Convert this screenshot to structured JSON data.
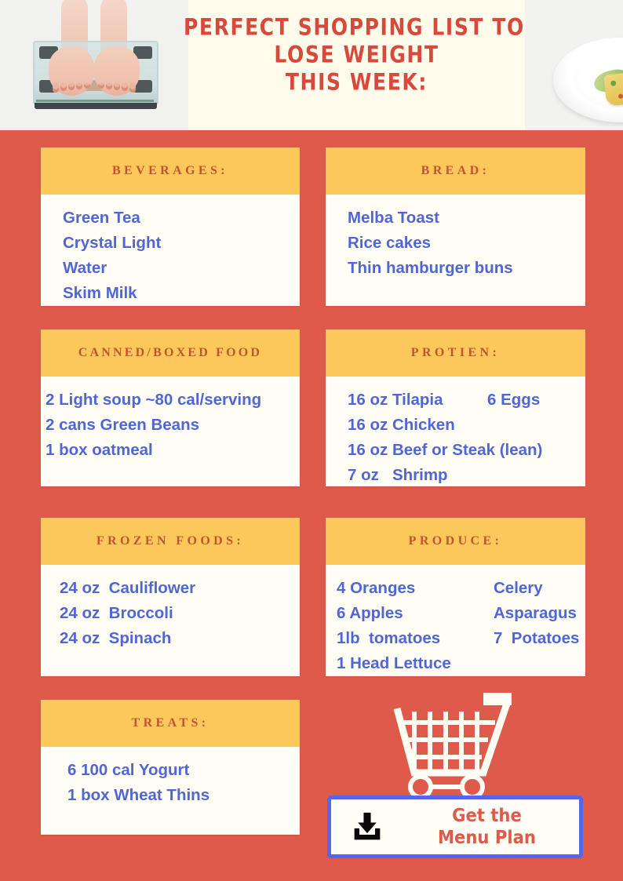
{
  "header": {
    "title_lines": [
      "Perfect Shopping List to",
      "Lose Weight",
      "This Week:"
    ],
    "left_photo_alt": "feet-on-bathroom-scale-photo",
    "right_photo_alt": "healthy-plate-frittata-tomatoes-photo",
    "title_color": "#D9483C",
    "title_panel_color": "#FFFCEB"
  },
  "theme": {
    "background": "#DE5B4B",
    "card_header_bg": "#FDC85B",
    "card_header_text": "#C2552F",
    "card_body_bg": "#FFFDF4",
    "item_text": "#4F66D6",
    "cta_border": "#5566E8",
    "cta_text": "#DE5B4B"
  },
  "cards": [
    {
      "id": "beverages",
      "heading": "Beverages:",
      "items": [
        "Green Tea",
        "Crystal Light",
        "Water",
        "Skim Milk"
      ]
    },
    {
      "id": "bread",
      "heading": "Bread:",
      "items": [
        "Melba Toast",
        "Rice cakes",
        "Thin hamburger buns"
      ]
    },
    {
      "id": "canned",
      "heading": "Canned/Boxed Food",
      "items": [
        "2 Light soup ~80 cal/serving",
        "2 cans Green Beans",
        "1 box oatmeal"
      ]
    },
    {
      "id": "protein",
      "heading": "Protien:",
      "items_left": [
        "16 oz Tilapia",
        "16 oz Chicken",
        "16 oz Beef or Steak (lean)",
        "7 oz   Shrimp"
      ],
      "items_right": [
        "6 Eggs",
        "",
        "",
        ""
      ]
    },
    {
      "id": "frozen",
      "heading": "Frozen Foods:",
      "items": [
        "24 oz  Cauliflower",
        "24 oz  Broccoli",
        "24 oz  Spinach"
      ]
    },
    {
      "id": "produce",
      "heading": "Produce:",
      "items_left": [
        "4 Oranges",
        "6 Apples",
        "1lb  tomatoes",
        "1 Head Lettuce"
      ],
      "items_right": [
        "Celery",
        "Asparagus",
        "7  Potatoes",
        ""
      ]
    },
    {
      "id": "treats",
      "heading": "Treats:",
      "items": [
        "6 100 cal Yogurt",
        "1 box Wheat Thins"
      ]
    }
  ],
  "cart_icon": "shopping-cart-icon",
  "cta": {
    "icon": "download-icon",
    "line1": "Get the",
    "line2": "Menu Plan"
  }
}
